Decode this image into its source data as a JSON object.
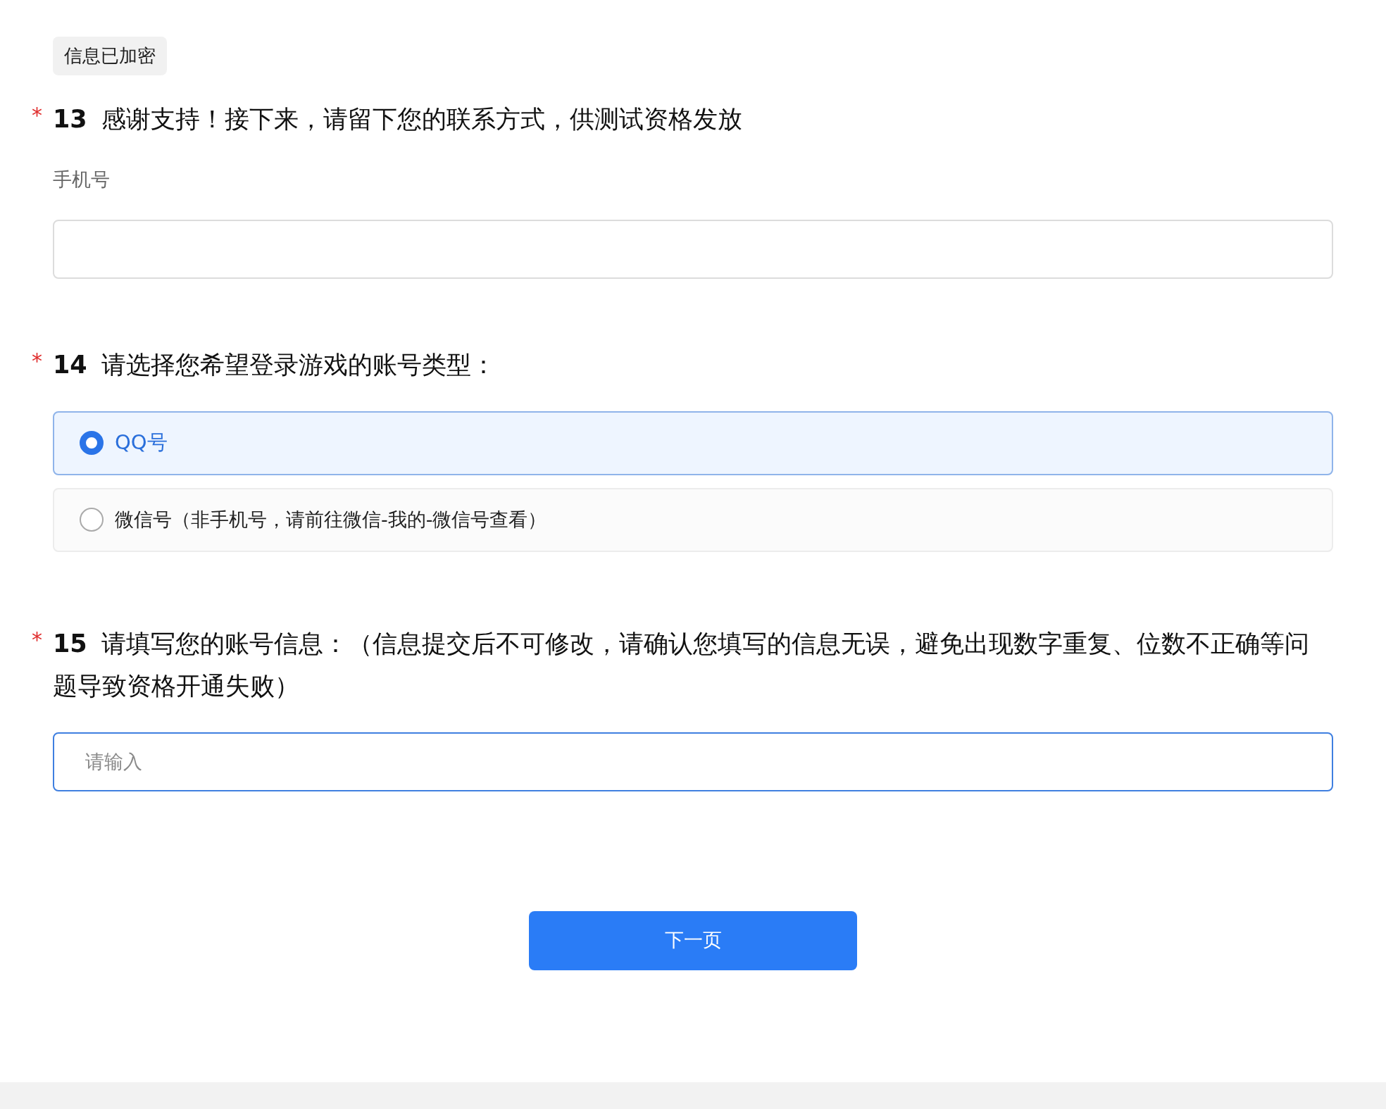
{
  "badge": "信息已加密",
  "questions": [
    {
      "kind": "text",
      "required": "*",
      "number": "13",
      "title": "感谢支持！接下来，请留下您的联系方式，供测试资格发放",
      "field_label": "手机号",
      "field": {
        "focused": false
      }
    },
    {
      "kind": "radio",
      "required": "*",
      "number": "14",
      "title": "请选择您希望登录游戏的账号类型：",
      "options": [
        {
          "label": "QQ号",
          "selected": true
        },
        {
          "label": "微信号（非手机号，请前往微信-我的-微信号查看）",
          "selected": false
        }
      ]
    },
    {
      "kind": "text",
      "required": "*",
      "number": "15",
      "title": "请填写您的账号信息：（信息提交后不可修改，请确认您填写的信息无误，避免出现数字重复、位数不正确等问题导致资格开通失败）",
      "field": {
        "placeholder": "请输入",
        "focused": true
      }
    }
  ],
  "next_button": "下一页"
}
